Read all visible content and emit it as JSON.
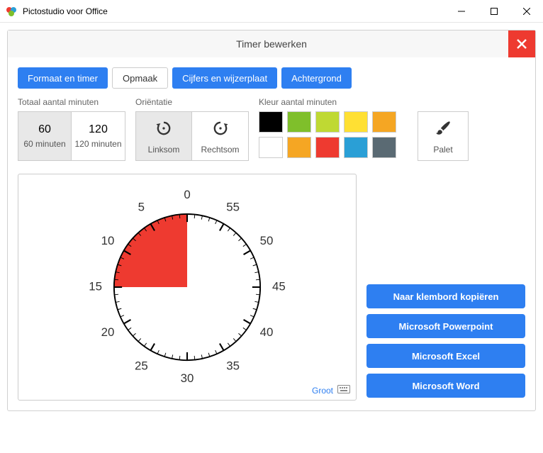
{
  "app": {
    "title": "Pictostudio voor Office"
  },
  "dialog": {
    "title": "Timer bewerken"
  },
  "tabs": [
    {
      "label": "Formaat en timer",
      "style": "active-blue"
    },
    {
      "label": "Opmaak",
      "style": "active-white"
    },
    {
      "label": "Cijfers en wijzerplaat",
      "style": "active-blue"
    },
    {
      "label": "Achtergrond",
      "style": "active-blue"
    }
  ],
  "minutes": {
    "title": "Totaal aantal minuten",
    "options": [
      {
        "value": "60",
        "sub": "60 minuten",
        "selected": true
      },
      {
        "value": "120",
        "sub": "120 minuten",
        "selected": false
      }
    ]
  },
  "orientation": {
    "title": "Oriëntatie",
    "options": [
      {
        "label": "Linksom",
        "selected": true,
        "icon": "ccw"
      },
      {
        "label": "Rechtsom",
        "selected": false,
        "icon": "cw"
      }
    ]
  },
  "colors": {
    "title": "Kleur aantal minuten",
    "swatches": [
      "#000000",
      "#7fbf2b",
      "#bfd933",
      "#ffe033",
      "#f5a623",
      "#ffffff",
      "#f5a623",
      "#ee3a30",
      "#2a9fd6",
      "#5a6a73"
    ]
  },
  "palette": {
    "label": "Palet"
  },
  "preview": {
    "size_label": "Groot",
    "dial_labels": [
      "0",
      "5",
      "10",
      "15",
      "20",
      "25",
      "30",
      "35",
      "40",
      "45",
      "50",
      "55"
    ],
    "filled_minutes": 15,
    "fill_color": "#ee3a30"
  },
  "side_buttons": [
    "Naar klembord kopiëren",
    "Microsoft Powerpoint",
    "Microsoft Excel",
    "Microsoft Word"
  ],
  "chart_data": {
    "type": "pie",
    "title": "Timer",
    "total_minutes": 60,
    "elapsed_minutes": 15,
    "direction": "counter-clockwise",
    "fill_color": "#ee3a30",
    "tick_interval_major": 5,
    "tick_interval_minor": 1,
    "labels": [
      0,
      5,
      10,
      15,
      20,
      25,
      30,
      35,
      40,
      45,
      50,
      55
    ]
  }
}
